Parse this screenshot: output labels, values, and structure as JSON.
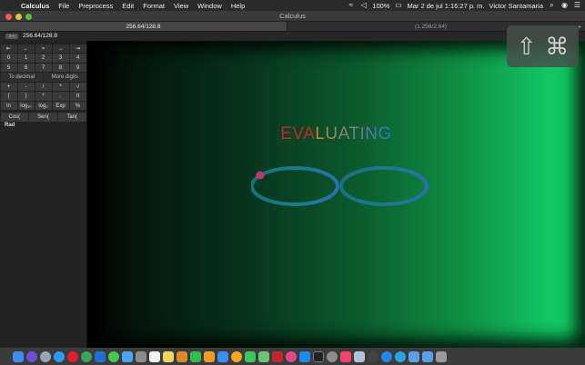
{
  "menubar": {
    "app": "Calculus",
    "items": [
      "File",
      "Preprocess",
      "Edit",
      "Format",
      "View",
      "Window",
      "Help"
    ],
    "battery": "100%",
    "datetime": "Mar 2 de jul  1:16:27 p. m.",
    "user": "Victor Santamaria"
  },
  "window": {
    "title": "Calculus"
  },
  "tabs": [
    {
      "label": "256.64/128.8"
    },
    {
      "label": "(1.256/2.64)"
    }
  ],
  "input": {
    "tag": "4  ∞",
    "value": "256.64/128.8"
  },
  "keypad": {
    "rows": [
      [
        "⇤",
        "←",
        "=",
        "→",
        "⇥"
      ],
      [
        "0",
        "1",
        "2",
        "3",
        "4"
      ],
      [
        "5",
        "6",
        "7",
        "8",
        "9"
      ],
      [
        "+",
        "-",
        "/",
        "*",
        "√"
      ],
      [
        "(",
        ")",
        "*",
        ".",
        "π"
      ],
      [
        "ln",
        "log₁₀",
        "log₂",
        "Exp",
        "%"
      ]
    ],
    "to_decimal": "To decimal",
    "more_digits": "More digits",
    "trig": [
      "Cos(",
      "Sen(",
      "Tan("
    ],
    "mode": "Rad"
  },
  "status": {
    "text_red": "EVA",
    "text_gradient": "LUATING"
  },
  "overlay": {
    "shift": "⇧",
    "cmd": "⌘"
  },
  "colors": {
    "accent_red": "#c1272d",
    "accent_blue": "#2a5db0",
    "canvas_green": "#12d066"
  }
}
